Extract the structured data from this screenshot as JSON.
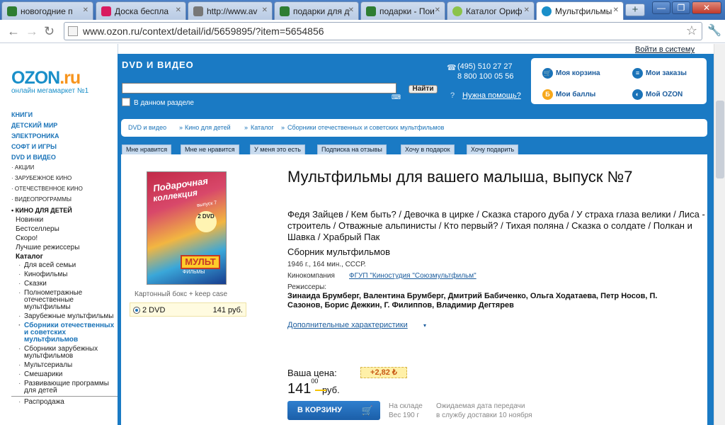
{
  "browser": {
    "tabs": [
      {
        "label": "новогодние п",
        "color": "#2e7d32"
      },
      {
        "label": "Доска беспла",
        "color": "#d81b60"
      },
      {
        "label": "http://www.av",
        "color": "#777777"
      },
      {
        "label": "подарки для д",
        "color": "#2e7d32"
      },
      {
        "label": "подарки - Пои",
        "color": "#2e7d32"
      },
      {
        "label": "Каталог Ориф",
        "color": "#8bc34a"
      },
      {
        "label": "Мультфильмы",
        "color": "#1a8fc9"
      }
    ],
    "new_tab_label": "+",
    "url": "www.ozon.ru/context/detail/id/5659895/?item=5654856",
    "back": "←",
    "forward": "→",
    "reload": "↻",
    "star": "☆",
    "wrench": "🔧",
    "minimize": "—",
    "maximize": "❐",
    "close": "✕"
  },
  "site": {
    "login_link": "Войти в систему",
    "logo_main": "OZON",
    "logo_dot": ".ru",
    "tagline": "онлайн мегамаркет №1",
    "section_title": "DVD И ВИДЕО",
    "search_placeholder": "",
    "search_button": "Найти",
    "keyboard_icon": "⌨",
    "in_section_label": "В данном разделе",
    "phone1": "(495) 510 27 27",
    "phone2": "8 800 100 05 56",
    "help": "Нужна помощь?",
    "userbox": {
      "cart": "Моя корзина",
      "orders": "Мои заказы",
      "points": "Мои баллы",
      "my_ozon": "Мой OZON"
    }
  },
  "leftnav": {
    "top": [
      "КНИГИ",
      "ДЕТСКИЙ МИР",
      "ЭЛЕКТРОНИКА",
      "СОФТ И ИГРЫ",
      "DVD И ВИДЕО"
    ],
    "sub": [
      "· АКЦИИ",
      "· ЗАРУБЕЖНОЕ КИНО",
      "· ОТЕЧЕСТВЕННОЕ КИНО",
      "· ВИДЕОПРОГРАММЫ"
    ],
    "current": "• КИНО ДЛЯ ДЕТЕЙ",
    "items": [
      "Новинки",
      "Бестселлеры",
      "Скоро!",
      "Лучшие режиссеры"
    ],
    "catalog": "Каталог",
    "leaves": [
      "Для всей семьи",
      "Кинофильмы",
      "Сказки",
      "Полнометражные отечественные мультфильмы",
      "Зарубежные мультфильмы",
      "Сборники отечественных и советских мультфильмов",
      "Сборники зарубежных мультфильмов",
      "Мультсериалы",
      "Смешарики",
      "Развивающие программы для детей",
      "Распродажа"
    ]
  },
  "breadcrumb": [
    "DVD и видео",
    "Кино для детей",
    "Каталог",
    "Сборники отечественных и советских мультфильмов"
  ],
  "breadcrumb_sep": "»",
  "social_tabs": [
    "Мне нравится",
    "Мне не нравится",
    "У меня это есть",
    "Подписка на отзывы",
    "Хочу в подарок",
    "Хочу подарить"
  ],
  "product": {
    "cover_t1": "Подарочная",
    "cover_t2": "коллекция",
    "cover_issue": "выпуск 7",
    "cover_badge": "2 DVD",
    "cover_mult": "МУЛЬТ",
    "cover_filmy": "ФИЛЬМЫ",
    "cover_caption": "Картонный бокс + keep case",
    "variant_label": "2 DVD",
    "variant_price": "141 руб.",
    "title": "Мультфильмы для вашего малыша, выпуск №7",
    "titles": "Федя Зайцев / Кем быть? / Девочка в цирке / Сказка старого дуба / У страха глаза велики / Лиса - строитель / Отважные альпинисты / Кто первый? / Тихая поляна / Сказка о солдате / Полкан и Шавка / Храбрый Пак",
    "subtitle": "Сборник мультфильмов",
    "year_line": "1946 г., 164 мин., СССР.",
    "studio_label": "Кинокомпания",
    "studio": "ФГУП \"Киностудия \"Союзмультфильм\"",
    "directors_label": "Режиссеры:",
    "directors": "Зинаида Брумберг, Валентина Брумберг, Дмитрий Бабиченко, Ольга Ходатаева, Петр Носов, П. Сазонов, Борис Дежкин, Г. Филиппов, Владимир Дегтярев",
    "more_link": "Дополнительные характеристики",
    "more_arrow": "▾",
    "price_label": "Ваша цена:",
    "bonus": "+2,82 ₺",
    "price_main": "141",
    "price_kop": "00",
    "price_cur": "руб.",
    "cart_button": "В КОРЗИНУ",
    "cart_icon": "🛒",
    "stock": [
      "На складе",
      "Вес 190 г"
    ],
    "delivery": [
      "Ожидаемая дата передачи",
      "в службу доставки 10 ноября"
    ]
  }
}
